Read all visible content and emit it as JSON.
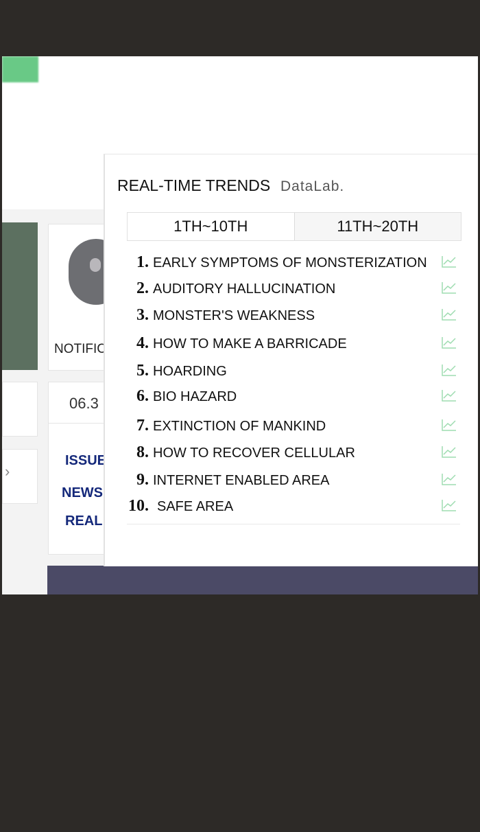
{
  "background": {
    "notification_partial": "NOTIFIC",
    "date_partial": "06.3",
    "links_partial": [
      "ISSUE",
      "NEWS",
      "REAL"
    ],
    "chevron": "›"
  },
  "panel": {
    "title": "REAL-TIME TRENDS",
    "brand": "DataLab.",
    "tabs": [
      {
        "label": "1TH~10TH",
        "active": true
      },
      {
        "label": "11TH~20TH",
        "active": false
      }
    ],
    "items": [
      {
        "rank": "1.",
        "term": "EARLY SYMPTOMS OF MONSTERIZATION"
      },
      {
        "rank": "2.",
        "term": "AUDITORY HALLUCINATION"
      },
      {
        "rank": "3.",
        "term": "MONSTER'S WEAKNESS"
      },
      {
        "rank": "4.",
        "term": "HOW TO MAKE A BARRICADE"
      },
      {
        "rank": "5.",
        "term": "HOARDING"
      },
      {
        "rank": "6.",
        "term": "BIO HAZARD"
      },
      {
        "rank": "7.",
        "term": "EXTINCTION OF MANKIND"
      },
      {
        "rank": "8.",
        "term": "HOW TO RECOVER CELLULAR"
      },
      {
        "rank": "9.",
        "term": "INTERNET ENABLED AREA"
      },
      {
        "rank": "10.",
        "term": "SAFE AREA"
      }
    ],
    "trend_icon": "trend-chart-icon"
  },
  "colors": {
    "accent_green": "#4fc071",
    "link_blue": "#14287a",
    "surround": "#2d2a27"
  }
}
